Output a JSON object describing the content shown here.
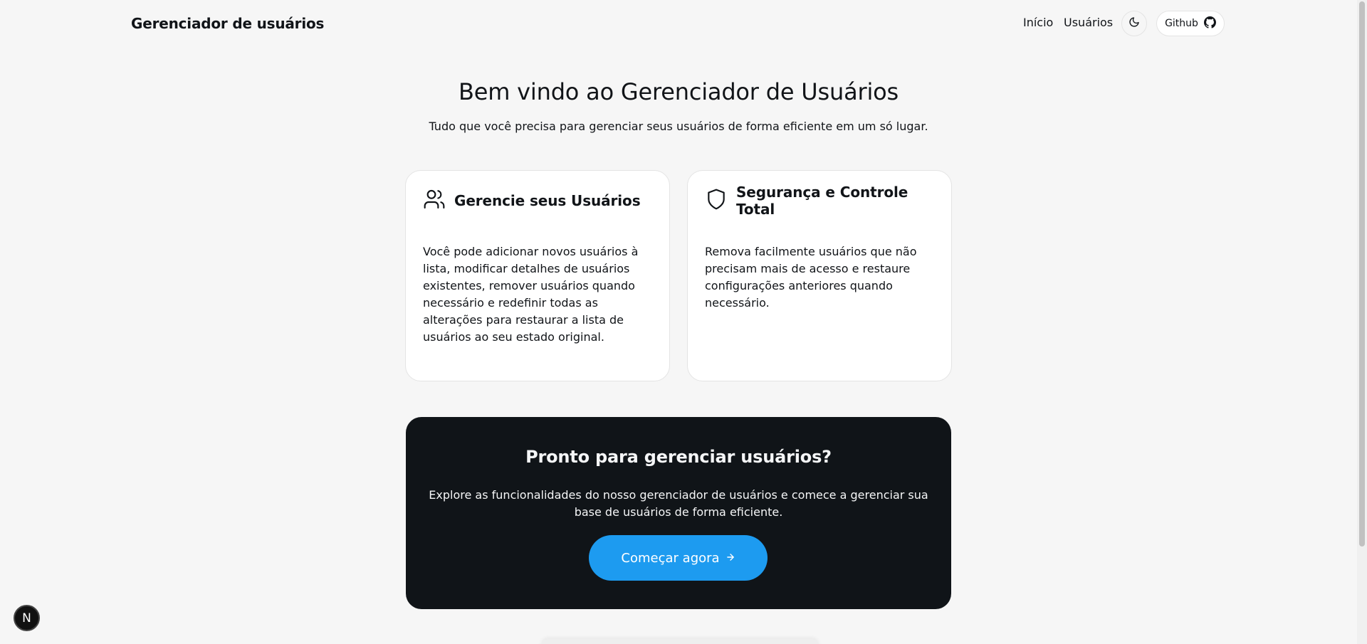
{
  "header": {
    "brand": "Gerenciador de usuários",
    "nav": [
      {
        "label": "Início"
      },
      {
        "label": "Usuários"
      }
    ],
    "theme_icon": "moon-icon",
    "github": {
      "label": "Github",
      "icon": "github-icon"
    }
  },
  "hero": {
    "title": "Bem vindo ao Gerenciador de Usuários",
    "subtitle": "Tudo que você precisa para gerenciar seus usuários de forma eficiente em um só lugar."
  },
  "features": [
    {
      "icon": "users-icon",
      "title": "Gerencie seus Usuários",
      "text": "Você pode adicionar novos usuários à lista, modificar detalhes de usuários existentes, remover usuários quando necessário e redefinir todas as alterações para restaurar a lista de usuários ao seu estado original."
    },
    {
      "icon": "shield-icon",
      "title": "Segurança e Controle Total",
      "text": "Remova facilmente usuários que não precisam mais de acesso e restaure configurações anteriores quando necessário."
    }
  ],
  "cta": {
    "title": "Pronto para gerenciar usuários?",
    "text": "Explore as funcionalidades do nosso gerenciador de usuários e comece a gerenciar sua base de usuários de forma eficiente.",
    "button_label": "Começar agora",
    "button_icon": "arrow-right-icon"
  },
  "dev_badge": {
    "label": "N"
  },
  "colors": {
    "background": "#f6f6f6",
    "cta_background": "#101418",
    "accent": "#1d9bf0"
  }
}
